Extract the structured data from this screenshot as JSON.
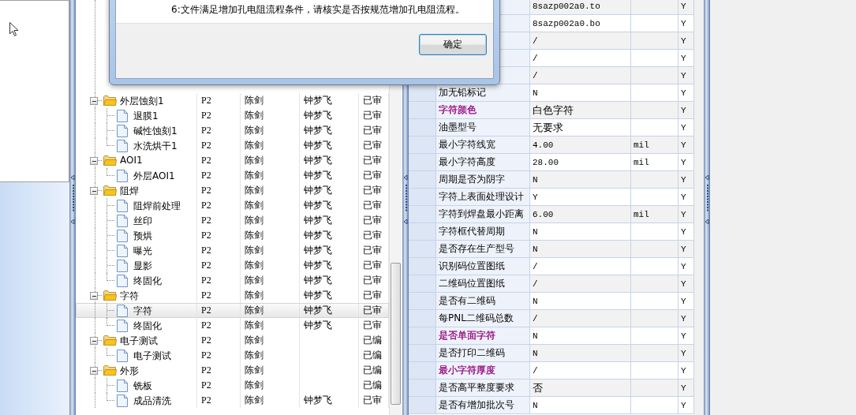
{
  "dialog": {
    "message": "6:文件满足增加孔电阻流程条件，请核实是否按规范增加孔电阻流程。",
    "buttons": [
      "确定"
    ]
  },
  "tree": {
    "rows": [
      {
        "label": "外层蚀刻1",
        "expanded": true,
        "selected": false,
        "column_2": "P2",
        "column_3": "陈剑",
        "column_4": "钟梦飞",
        "column_5": "已审",
        "children": [
          {
            "label": "退膜1",
            "selected": false,
            "column_2": "P2",
            "column_3": "陈剑",
            "column_4": "钟梦飞",
            "column_5": "已审"
          },
          {
            "label": "碱性蚀刻1",
            "selected": false,
            "column_2": "P2",
            "column_3": "陈剑",
            "column_4": "钟梦飞",
            "column_5": "已审"
          },
          {
            "label": "水洗烘干1",
            "selected": false,
            "column_2": "P2",
            "column_3": "陈剑",
            "column_4": "钟梦飞",
            "column_5": "已审"
          }
        ]
      },
      {
        "label": "AOI1",
        "expanded": true,
        "selected": false,
        "column_2": "P2",
        "column_3": "陈剑",
        "column_4": "钟梦飞",
        "column_5": "已审",
        "children": [
          {
            "label": "外层AOI1",
            "selected": false,
            "column_2": "P2",
            "column_3": "陈剑",
            "column_4": "钟梦飞",
            "column_5": "已审"
          }
        ]
      },
      {
        "label": "阻焊",
        "expanded": true,
        "selected": false,
        "column_2": "P2",
        "column_3": "陈剑",
        "column_4": "钟梦飞",
        "column_5": "已审",
        "children": [
          {
            "label": "阻焊前处理",
            "selected": false,
            "column_2": "P2",
            "column_3": "陈剑",
            "column_4": "钟梦飞",
            "column_5": "已审"
          },
          {
            "label": "丝印",
            "selected": false,
            "column_2": "P2",
            "column_3": "陈剑",
            "column_4": "钟梦飞",
            "column_5": "已审"
          },
          {
            "label": "预烘",
            "selected": false,
            "column_2": "P2",
            "column_3": "陈剑",
            "column_4": "钟梦飞",
            "column_5": "已审"
          },
          {
            "label": "曝光",
            "selected": false,
            "column_2": "P2",
            "column_3": "陈剑",
            "column_4": "钟梦飞",
            "column_5": "已审"
          },
          {
            "label": "显影",
            "selected": false,
            "column_2": "P2",
            "column_3": "陈剑",
            "column_4": "钟梦飞",
            "column_5": "已审"
          },
          {
            "label": "终固化",
            "selected": false,
            "column_2": "P2",
            "column_3": "陈剑",
            "column_4": "钟梦飞",
            "column_5": "已审"
          }
        ]
      },
      {
        "label": "字符",
        "expanded": true,
        "selected": false,
        "column_2": "P2",
        "column_3": "陈剑",
        "column_4": "钟梦飞",
        "column_5": "已审",
        "children": [
          {
            "label": "字符",
            "selected": true,
            "column_2": "P2",
            "column_3": "陈剑",
            "column_4": "钟梦飞",
            "column_5": "已审"
          },
          {
            "label": "终固化",
            "selected": false,
            "column_2": "P2",
            "column_3": "陈剑",
            "column_4": "钟梦飞",
            "column_5": "已审"
          }
        ]
      },
      {
        "label": "电子测试",
        "expanded": true,
        "selected": false,
        "column_2": "P2",
        "column_3": "陈剑",
        "column_5": "已编",
        "children": [
          {
            "label": "电子测试",
            "selected": false,
            "column_2": "P2",
            "column_3": "陈剑",
            "column_5": "已编"
          }
        ]
      },
      {
        "label": "外形",
        "expanded": true,
        "selected": false,
        "column_2": "P2",
        "column_3": "陈剑",
        "column_5": "已编",
        "children": [
          {
            "label": "铣板",
            "selected": false,
            "column_2": "P2",
            "column_3": "陈剑",
            "column_5": "已编"
          },
          {
            "label": "成品清洗",
            "selected": false,
            "column_2": "P2",
            "column_3": "陈剑",
            "column_4": "钟梦飞",
            "column_5": "已审"
          }
        ]
      }
    ]
  },
  "properties": {
    "rows": [
      {
        "value": "8sazp002a0.to",
        "column_5": "Y"
      },
      {
        "value": "8sazp002a0.bo",
        "column_5": "Y"
      },
      {
        "value": "/",
        "column_5": "Y"
      },
      {
        "value": "/",
        "column_5": "Y"
      },
      {
        "value": "/",
        "column_5": "Y"
      },
      {
        "name": "加无铅标记",
        "value": "N",
        "column_5": "Y"
      },
      {
        "name": "字符颜色",
        "color": "#a3238e",
        "value": "白色字符",
        "column_5": "Y"
      },
      {
        "name": "油墨型号",
        "value": "无要求",
        "column_5": "Y"
      },
      {
        "name": "最小字符线宽",
        "value": "4.00",
        "unit": "mil",
        "column_5": "Y"
      },
      {
        "name": "最小字符高度",
        "value": "28.00",
        "unit": "mil",
        "column_5": "Y"
      },
      {
        "name": "周期是否为阴字",
        "value": "N",
        "column_5": "Y"
      },
      {
        "name": "字符上表面处理设计",
        "value": "Y",
        "column_5": "Y"
      },
      {
        "name": "字符到焊盘最小距离",
        "value": "6.00",
        "unit": "mil",
        "column_5": "Y"
      },
      {
        "name": "字符框代替周期",
        "value": "N",
        "column_5": "Y"
      },
      {
        "name": "是否存在生产型号",
        "value": "N",
        "column_5": "Y"
      },
      {
        "name": "识别码位置图纸",
        "value": "/",
        "column_5": "Y"
      },
      {
        "name": "二维码位置图纸",
        "value": "/",
        "column_5": "Y"
      },
      {
        "name": "是否有二维码",
        "value": "N",
        "column_5": "Y"
      },
      {
        "name": "每PNL二维码总数",
        "value": "/",
        "column_5": "Y"
      },
      {
        "name": "是否单面字符",
        "color": "#a3238e",
        "value": "N",
        "column_5": "Y"
      },
      {
        "name": "是否打印二维码",
        "value": "N",
        "column_5": "Y"
      },
      {
        "name": "最小字符厚度",
        "color": "#a3238e",
        "value": "/",
        "column_5": "Y"
      },
      {
        "name": "是否高平整度要求",
        "value": "否",
        "column_5": "Y"
      },
      {
        "name": "是否有增加批次号",
        "value": "N",
        "column_5": "Y"
      }
    ]
  }
}
